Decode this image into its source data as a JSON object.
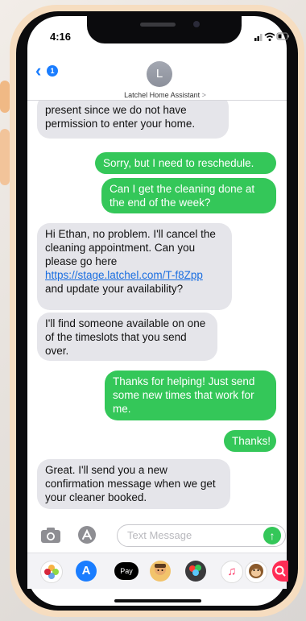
{
  "status": {
    "time": "4:16"
  },
  "header": {
    "back_count": "1",
    "avatar_initial": "L",
    "contact_name": "Latchel Home Assistant",
    "chevron": ">"
  },
  "messages": [
    {
      "from": "them",
      "text": "present since we do not have permission to enter your home."
    },
    {
      "from": "me",
      "text": "Sorry, but I need to reschedule."
    },
    {
      "from": "me",
      "text": "Can I get the cleaning done at the end of the week?"
    },
    {
      "from": "them",
      "text_before_link": "Hi Ethan, no problem. I'll cancel the cleaning appointment. Can you please go here ",
      "link": "https://stage.latchel.com/T-f8Zpp",
      "text_after_link": " and update your availability?"
    },
    {
      "from": "them",
      "text": "I'll find someone available on one of the timeslots that you send over."
    },
    {
      "from": "me",
      "text": "Thanks for helping! Just send some new times that work for me."
    },
    {
      "from": "me",
      "text": "Thanks!"
    },
    {
      "from": "them",
      "text": "Great. I'll send you a new confirmation message when we get your cleaner booked."
    }
  ],
  "composer": {
    "placeholder": "Text Message"
  },
  "app_drawer": [
    {
      "icon": "photos-icon"
    },
    {
      "icon": "app-store-icon"
    },
    {
      "icon": "apple-pay-icon",
      "label": "Pay"
    },
    {
      "icon": "memoji-icon"
    },
    {
      "icon": "digital-touch-icon"
    },
    {
      "icon": "music-icon"
    },
    {
      "icon": "monkey-sticker-icon"
    },
    {
      "icon": "image-search-icon"
    }
  ],
  "colors": {
    "outgoing": "#34c759",
    "incoming": "#e5e5ea",
    "accent": "#1a7dff",
    "frame": "#f6ddc0"
  }
}
